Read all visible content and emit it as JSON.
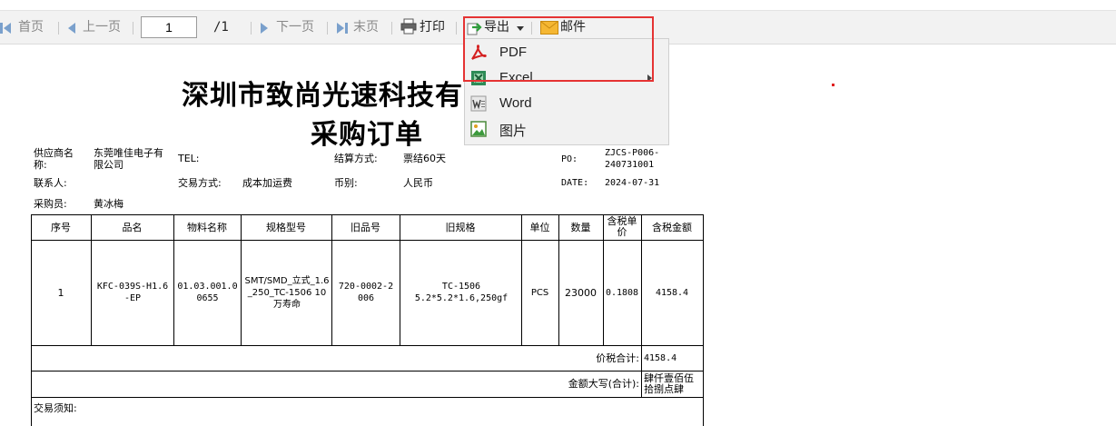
{
  "toolbar": {
    "first": "首页",
    "prev": "上一页",
    "page_value": "1",
    "page_total": "/1",
    "next": "下一页",
    "last": "末页",
    "print": "打印",
    "export": "导出",
    "mail": "邮件"
  },
  "export_menu": {
    "items": [
      {
        "label": "PDF",
        "icon": "pdf-icon"
      },
      {
        "label": "Excel",
        "icon": "excel-icon"
      },
      {
        "label": "Word",
        "icon": "word-icon"
      },
      {
        "label": "图片",
        "icon": "image-icon"
      }
    ]
  },
  "doc": {
    "title_company": "深圳市致尚光速科技有",
    "title_doc": "采购订单",
    "fields": {
      "supplier_label": "供应商名称:",
      "supplier_value": "东莞唯佳电子有限公司",
      "tel_label": "TEL:",
      "settle_label": "结算方式:",
      "settle_value": "票结60天",
      "po_label": "PO:",
      "po_value": "ZJCS-P006-240731001",
      "contact_label": "联系人:",
      "trade_label": "交易方式:",
      "trade_value": "成本加运费",
      "currency_label": "币别:",
      "currency_value": "人民币",
      "date_label": "DATE:",
      "date_value": "2024-07-31",
      "buyer_label": "采购员:",
      "buyer_value": "黄冰梅"
    },
    "table": {
      "headers": [
        "序号",
        "品名",
        "物料名称",
        "规格型号",
        "旧品号",
        "旧规格",
        "单位",
        "数量",
        "含税单价",
        "含税金额"
      ],
      "row": {
        "no": "1",
        "name": "KFC-039S-H1.6-EP",
        "material": "01.03.001.00655",
        "spec": "SMT/SMD_立式_1.6_250_TC-1506 10万寿命",
        "old_no": "720-0002-2006",
        "old_spec": "TC-1506 5.2*5.2*1.6,250gf",
        "unit": "PCS",
        "qty": "23000",
        "unit_price": "0.1808",
        "amount": "4158.4"
      },
      "total_label": "价税合计:",
      "total_value": "4158.4",
      "upper_label": "金额大写(合计):",
      "upper_value": "肆仟壹佰伍拾捌点肆",
      "notes_label": "交易须知:"
    }
  }
}
